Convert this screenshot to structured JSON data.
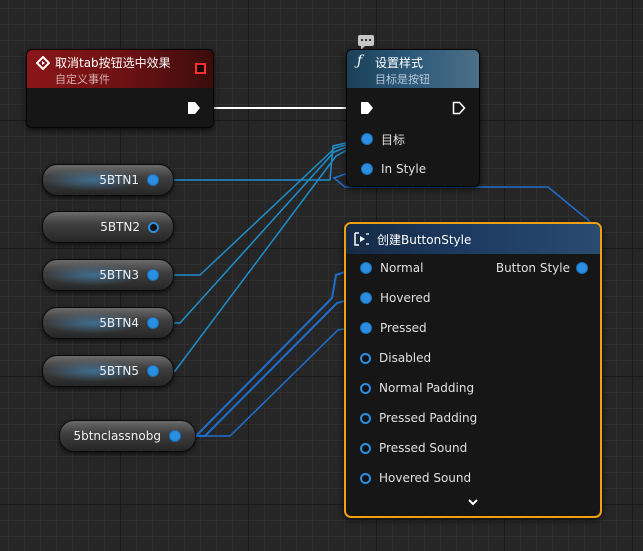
{
  "event_node": {
    "title": "取消tab按钮选中效果",
    "subtitle": "自定义事件",
    "icon": "diamond-event-icon",
    "color": "#8a1618"
  },
  "function_node": {
    "title": "设置样式",
    "subtitle": "目标是按钮",
    "icon": "function-f-icon",
    "comment_icon": "comment-bubble-icon",
    "pins": [
      "目标",
      "In Style"
    ]
  },
  "variables": [
    "5BTN1",
    "5BTN2",
    "5BTN3",
    "5BTN4",
    "5BTN5",
    "5btnclassnobg"
  ],
  "make_node": {
    "title": "创建ButtonStyle",
    "output": "Button Style",
    "pins": [
      "Normal",
      "Hovered",
      "Pressed",
      "Disabled",
      "Normal Padding",
      "Pressed Padding",
      "Pressed Sound",
      "Hovered Sound"
    ],
    "connected_pins": [
      "Normal",
      "Hovered",
      "Pressed"
    ],
    "selection_color": "#f0a010",
    "expand_icon": "chevron-down-icon"
  },
  "colors": {
    "exec": "#ffffff",
    "struct_pin": "#2b8ee0",
    "background": "#262626"
  }
}
